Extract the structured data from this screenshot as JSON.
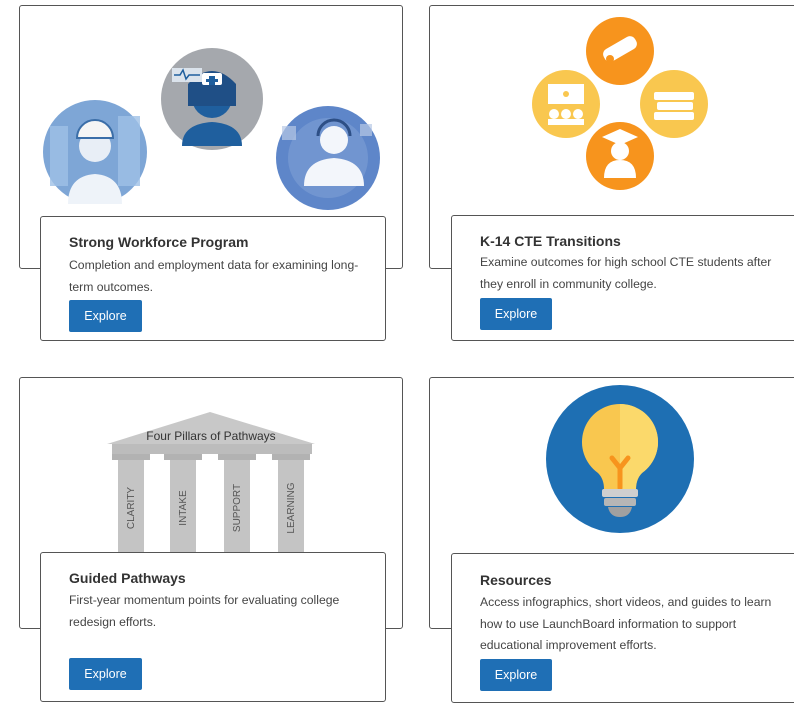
{
  "cards": [
    {
      "title": "Strong Workforce Program",
      "description": "Completion and employment data for examining long-term outcomes.",
      "button": "Explore",
      "image": "workforce-illustration"
    },
    {
      "title": "K-14 CTE Transitions",
      "description": "Examine outcomes for high school CTE students after they enroll in community college.",
      "button": "Explore",
      "image": "cte-icons"
    },
    {
      "title": "Guided Pathways",
      "description": "First-year momentum points for evaluating college redesign efforts.",
      "button": "Explore",
      "image": "pillars-illustration",
      "pillars": {
        "heading": "Four Pillars of Pathways",
        "labels": [
          "CLARITY",
          "INTAKE",
          "SUPPORT",
          "LEARNING"
        ]
      }
    },
    {
      "title": "Resources",
      "description": "Access infographics, short videos, and guides to learn how to use LaunchBoard information to support educational improvement efforts.",
      "button": "Explore",
      "image": "lightbulb-icon"
    }
  ],
  "colors": {
    "button": "#1f6fb5",
    "orange": "#f7941d",
    "yellow": "#f9c74f",
    "blue_circle": "#1e6fb3"
  }
}
